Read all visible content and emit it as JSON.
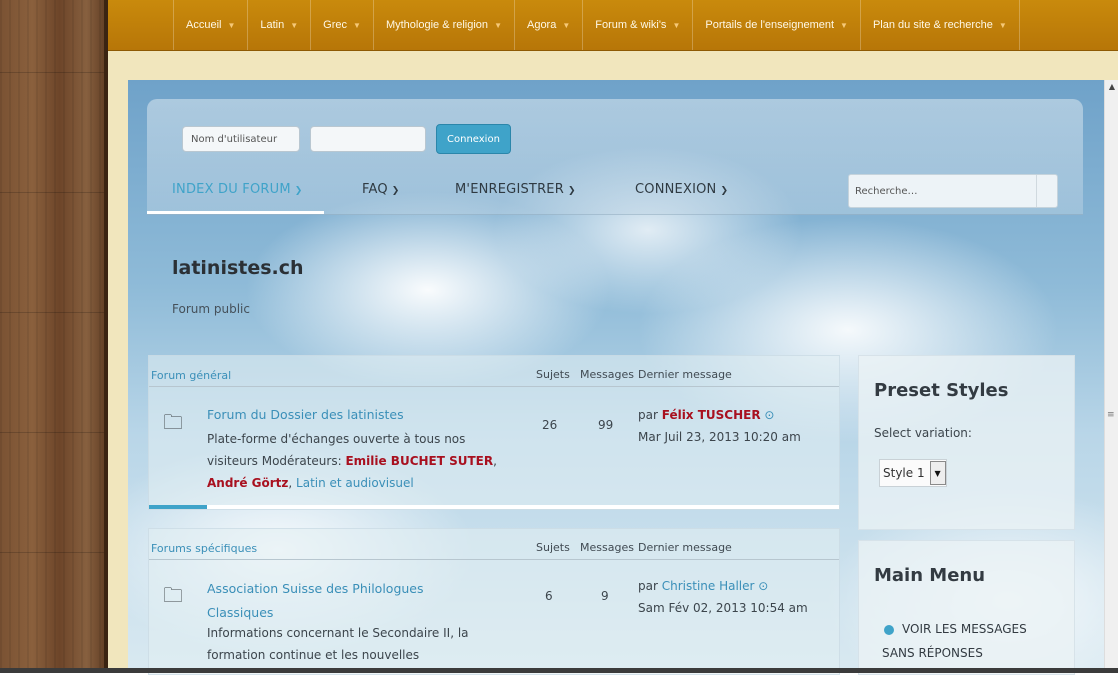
{
  "topnav": {
    "items": [
      "Accueil",
      "Latin",
      "Grec",
      "Mythologie & religion",
      "Agora",
      "Forum & wiki's",
      "Portails de l'enseignement",
      "Plan du site & recherche"
    ]
  },
  "login": {
    "username_placeholder": "Nom d'utilisateur",
    "password_value": "",
    "button": "Connexion"
  },
  "mainnav": {
    "index": "INDEX DU FORUM",
    "faq": "FAQ",
    "register": "M'ENREGISTRER",
    "login": "CONNEXION",
    "search_placeholder": "Recherche…"
  },
  "site": {
    "title": "latinistes.ch",
    "description": "Forum public"
  },
  "columns": {
    "topics": "Sujets",
    "posts": "Messages",
    "last": "Dernier message"
  },
  "categories": [
    {
      "name": "Forum général",
      "forum": {
        "title": "Forum du Dossier des latinistes",
        "desc_line1": "Plate-forme d'échanges ouverte à tous nos",
        "desc_line2": "visiteurs Modérateurs:",
        "mod1": "Emilie BUCHET SUTER",
        "mod2": "André Görtz",
        "mod3": "Latin et audiovisuel",
        "topics": "26",
        "posts": "99",
        "last_by_prefix": "par",
        "last_by": "Félix TUSCHER",
        "last_date": "Mar Juil 23, 2013 10:20 am"
      }
    },
    {
      "name": "Forums spécifiques",
      "forum": {
        "title_line1": "Association Suisse des Philologues",
        "title_line2": "Classiques",
        "desc_line1": "Informations concernant le Secondaire II, la",
        "desc_line2": "formation continue et les nouvelles",
        "topics": "6",
        "posts": "9",
        "last_by_prefix": "par",
        "last_by": "Christine Haller",
        "last_date": "Sam Fév 02, 2013 10:54 am"
      }
    }
  ],
  "sidebar": {
    "preset_title": "Preset Styles",
    "select_label": "Select variation:",
    "select_value": "Style 1",
    "menu_title": "Main Menu",
    "menu_item_line1": "VOIR LES MESSAGES",
    "menu_item_line2": "SANS RÉPONSES"
  },
  "colors": {
    "accent": "#3fa3c9",
    "nav": "#c98a0c",
    "moderator": "#a8101f"
  }
}
